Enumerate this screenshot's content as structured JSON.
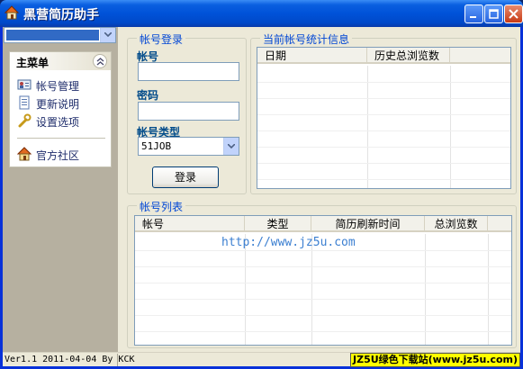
{
  "window": {
    "title": "黑营简历助手",
    "controls": {
      "minimize": "minimize",
      "maximize": "maximize",
      "close": "close"
    }
  },
  "sidebar": {
    "user_combo_value": "",
    "menu": {
      "title": "主菜单",
      "items": [
        {
          "label": "帐号管理",
          "icon": "id-card-icon"
        },
        {
          "label": "更新说明",
          "icon": "notepad-icon"
        },
        {
          "label": "设置选项",
          "icon": "wrench-icon"
        },
        {
          "label": "官方社区",
          "icon": "house-icon"
        }
      ]
    }
  },
  "login": {
    "group_title": "帐号登录",
    "account_label": "帐号",
    "account_value": "",
    "password_label": "密码",
    "password_value": "",
    "type_label": "帐号类型",
    "type_value": "51JOB",
    "login_button": "登录"
  },
  "stats": {
    "group_title": "当前帐号统计信息",
    "columns": [
      "日期",
      "历史总浏览数"
    ],
    "rows": []
  },
  "accounts": {
    "group_title": "帐号列表",
    "columns": [
      "帐号",
      "类型",
      "简历刷新时间",
      "总浏览数"
    ],
    "rows": []
  },
  "watermark": "http://www.jz5u.com",
  "statusbar": {
    "version": "Ver1.1 2011-04-04 By KCK",
    "badge": "JZ5U绿色下载站(www.jz5u.com)"
  },
  "colors": {
    "title_bar": "#0052d8",
    "group_title": "#0046d5",
    "field_label": "#004b8a",
    "badge_bg": "#ffff00",
    "watermark": "#3b7fd1"
  }
}
